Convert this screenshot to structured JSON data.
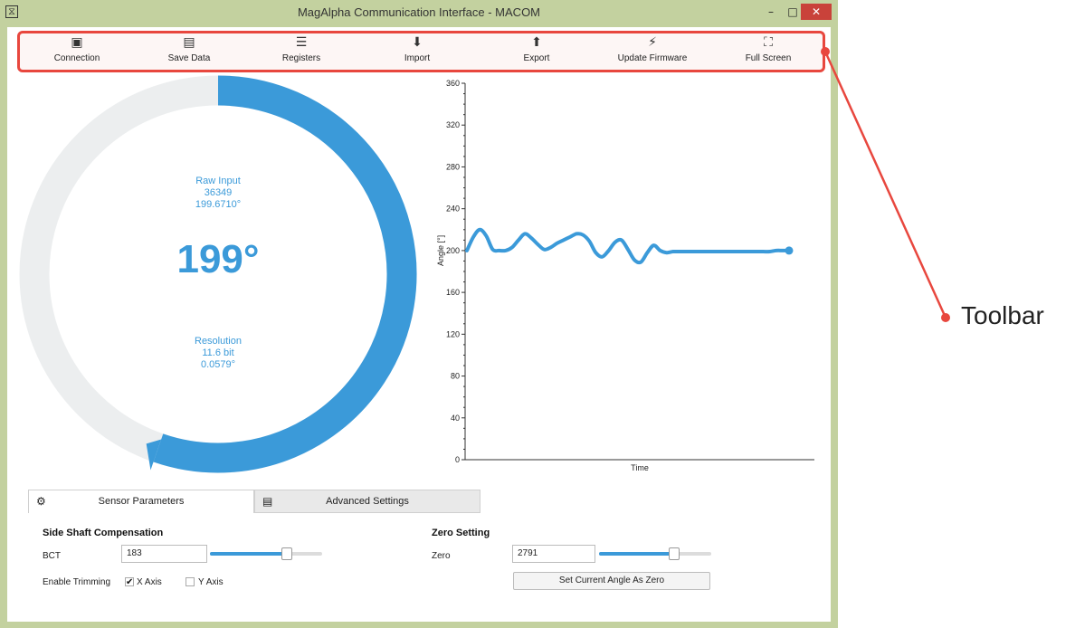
{
  "window": {
    "title": "MagAlpha Communication Interface - MACOM",
    "app_icon": "⧖",
    "minimize_glyph": "–",
    "maximize_glyph": "□",
    "close_glyph": "✕"
  },
  "toolbar": {
    "items": [
      {
        "label": "Connection",
        "icon": "usb-icon",
        "glyph": "▣"
      },
      {
        "label": "Save Data",
        "icon": "disk-icon",
        "glyph": "▤"
      },
      {
        "label": "Registers",
        "icon": "list-icon",
        "glyph": "☰"
      },
      {
        "label": "Import",
        "icon": "download-icon",
        "glyph": "⬇"
      },
      {
        "label": "Export",
        "icon": "upload-icon",
        "glyph": "⬆"
      },
      {
        "label": "Update Firmware",
        "icon": "lightning-icon",
        "glyph": "⚡"
      },
      {
        "label": "Full Screen",
        "icon": "fullscreen-icon",
        "glyph": "⛶"
      }
    ]
  },
  "annotation": {
    "label": "Toolbar",
    "color": "#e8473e"
  },
  "gauge": {
    "raw_input_label": "Raw Input",
    "raw_input_value": "36349",
    "raw_input_angle": "199.6710°",
    "angle_display": "199°",
    "angle_value": 199,
    "resolution_label": "Resolution",
    "resolution_bits": "11.6 bit",
    "resolution_deg": "0.0579°",
    "accent": "#3b9ad9",
    "track": "#eceeef"
  },
  "chart_data": {
    "type": "line",
    "xlabel": "Time",
    "ylabel": "Angle [°]",
    "ylim": [
      0,
      360
    ],
    "yticks": [
      0,
      40,
      80,
      120,
      160,
      200,
      240,
      280,
      320,
      360
    ],
    "x": [
      0,
      1,
      2,
      3,
      4,
      5,
      6,
      7,
      8,
      9,
      10,
      11,
      12,
      13,
      14,
      15,
      16,
      17,
      18,
      19,
      20,
      21,
      22,
      23,
      24,
      25,
      26,
      27,
      28,
      29,
      30,
      31,
      32,
      33,
      34,
      35,
      36,
      37,
      38,
      39,
      40,
      41,
      42,
      43,
      44,
      45,
      46,
      47,
      48,
      49,
      50
    ],
    "values": [
      200,
      213,
      220,
      214,
      201,
      200,
      200,
      203,
      210,
      216,
      212,
      206,
      201,
      203,
      207,
      210,
      213,
      216,
      215,
      209,
      198,
      194,
      200,
      208,
      210,
      201,
      191,
      189,
      198,
      205,
      200,
      198,
      199,
      199,
      199,
      199,
      199,
      199,
      199,
      199,
      199,
      199,
      199,
      199,
      199,
      199,
      199,
      199,
      200,
      200,
      200
    ],
    "color": "#3b9ad9",
    "grid": false
  },
  "tabs": [
    {
      "label": "Sensor Parameters",
      "icon": "gear-icon",
      "glyph": "⚙",
      "active": true
    },
    {
      "label": "Advanced Settings",
      "icon": "document-icon",
      "glyph": "▤",
      "active": false
    }
  ],
  "side_shaft": {
    "title": "Side Shaft Compensation",
    "bct_label": "BCT",
    "bct_value": "183",
    "bct_slider": 0.68,
    "enable_trimming_label": "Enable Trimming",
    "x_axis_label": "X Axis",
    "x_axis_checked": true,
    "y_axis_label": "Y Axis",
    "y_axis_checked": false,
    "check_glyph": "✔"
  },
  "zero_setting": {
    "title": "Zero Setting",
    "zero_label": "Zero",
    "zero_value": "2791",
    "zero_slider": 0.66,
    "set_zero_button": "Set Current Angle As Zero"
  }
}
